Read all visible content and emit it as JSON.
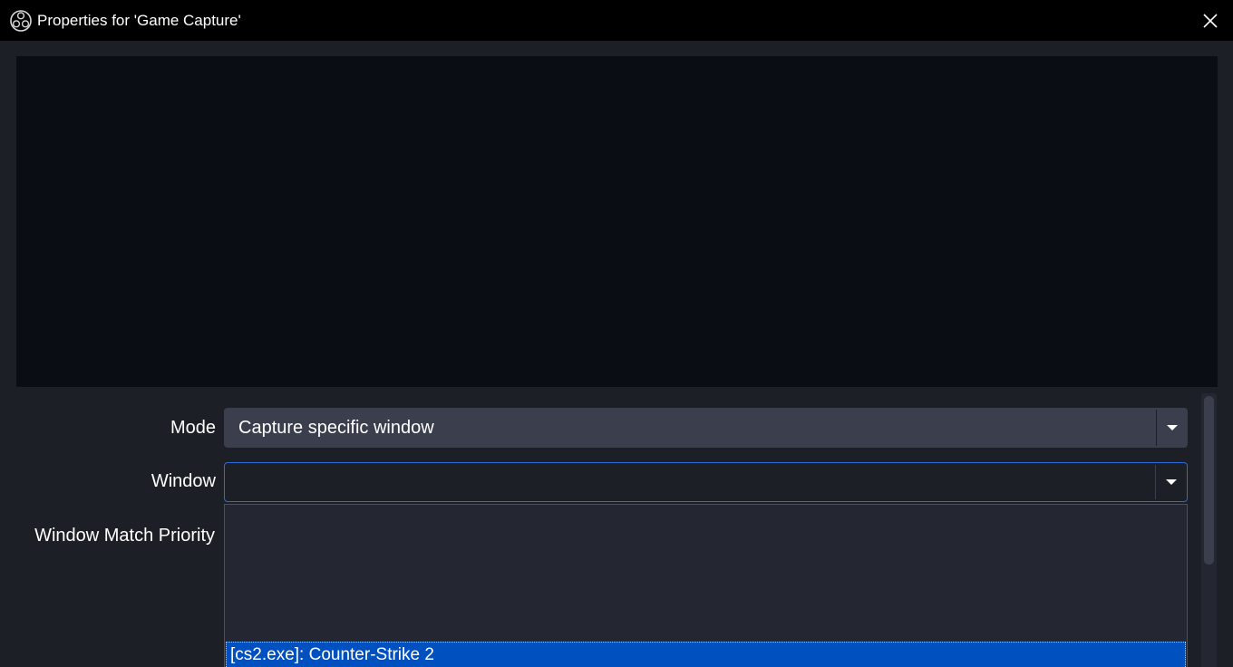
{
  "window": {
    "title": "Properties for 'Game Capture'",
    "app_icon": "obs-logo-icon",
    "close_icon": "close-icon"
  },
  "form": {
    "mode": {
      "label": "Mode",
      "value": "Capture specific window"
    },
    "window_field": {
      "label": "Window",
      "value": ""
    },
    "match_priority": {
      "label": "Window Match Priority"
    },
    "dropdown": {
      "items": [
        "[cs2.exe]: Counter-Strike 2"
      ],
      "selected_index": 0
    }
  },
  "colors": {
    "titlebar": "#000000",
    "background": "#1d1f26",
    "preview": "#0b0d14",
    "combo": "#3b3e4c",
    "focus_border": "#2e6bd9",
    "selection": "#0050c0"
  }
}
